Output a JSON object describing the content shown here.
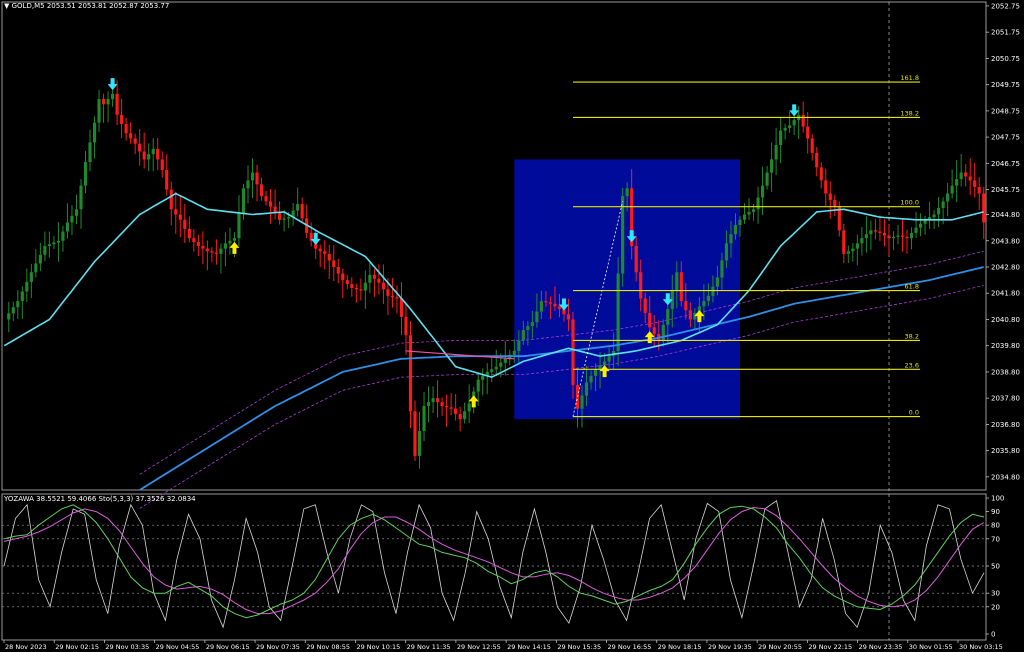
{
  "symbol_header": {
    "arrow": "▼",
    "symbol": "GOLD,M5",
    "ohlc": "2053.51 2053.81 2052.87 2053.77"
  },
  "indicator_header": {
    "name": "YOZAWA",
    "values": "38.5521 59.4066",
    "sto": "Sto(5,3,3)",
    "sto_values": "37.3526 32.0834"
  },
  "colors": {
    "background": "#000000",
    "bull_candle": "#1f8a2a",
    "bear_candle": "#ff1a1a",
    "ma_fast": "#5fe0f0",
    "ma_slow": "#2f8fe8",
    "envelope": "#a63bd6",
    "fib_line": "#e6e600",
    "fib_box": "#000c99",
    "arrow_up": "#ffee00",
    "arrow_down": "#33e6ff",
    "stoch_fast": "#d9d9d9",
    "stoch_main": "#5fd05f",
    "stoch_signal": "#d95fd9",
    "grid": "#c0c0c0"
  },
  "chart_data": [
    {
      "type": "candlestick",
      "ylim": [
        2034.3,
        2052.9
      ],
      "y_ticks": [
        "2052.75",
        "2051.75",
        "2050.75",
        "2049.75",
        "2048.75",
        "2047.75",
        "2046.75",
        "2045.75",
        "2044.80",
        "2043.80",
        "2042.80",
        "2041.80",
        "2040.80",
        "2039.80",
        "2038.80",
        "2037.80",
        "2036.80",
        "2035.80",
        "2034.80"
      ],
      "x_ticks": [
        "28 Nov 2023",
        "29 Nov 02:15",
        "29 Nov 03:35",
        "29 Nov 04:55",
        "29 Nov 06:15",
        "29 Nov 07:35",
        "29 Nov 08:55",
        "29 Nov 10:15",
        "29 Nov 11:35",
        "29 Nov 12:55",
        "29 Nov 14:15",
        "29 Nov 15:35",
        "29 Nov 16:55",
        "29 Nov 18:15",
        "29 Nov 19:35",
        "29 Nov 20:55",
        "29 Nov 22:15",
        "29 Nov 23:35",
        "30 Nov 01:55",
        "30 Nov 03:15"
      ],
      "close_path": [
        [
          0,
          2040.8
        ],
        [
          3,
          2041.5
        ],
        [
          6,
          2042.6
        ],
        [
          9,
          2043.6
        ],
        [
          12,
          2043.8
        ],
        [
          14,
          2044.5
        ],
        [
          16,
          2045.0
        ],
        [
          18,
          2046.8
        ],
        [
          20,
          2048.3
        ],
        [
          21,
          2049.2
        ],
        [
          22,
          2049.0
        ],
        [
          24,
          2049.4
        ],
        [
          25,
          2048.6
        ],
        [
          27,
          2047.9
        ],
        [
          29,
          2047.5
        ],
        [
          31,
          2046.9
        ],
        [
          33,
          2047.3
        ],
        [
          35,
          2046.5
        ],
        [
          37,
          2045.0
        ],
        [
          39,
          2044.6
        ],
        [
          41,
          2043.9
        ],
        [
          43,
          2043.6
        ],
        [
          45,
          2043.4
        ],
        [
          47,
          2043.3
        ],
        [
          49,
          2043.7
        ],
        [
          51,
          2043.9
        ],
        [
          53,
          2045.8
        ],
        [
          55,
          2046.4
        ],
        [
          57,
          2045.5
        ],
        [
          59,
          2045.1
        ],
        [
          61,
          2044.6
        ],
        [
          63,
          2044.7
        ],
        [
          65,
          2045.2
        ],
        [
          67,
          2044.1
        ],
        [
          69,
          2043.5
        ],
        [
          71,
          2043.3
        ],
        [
          73,
          2042.8
        ],
        [
          75,
          2042.3
        ],
        [
          77,
          2042.0
        ],
        [
          79,
          2041.9
        ],
        [
          81,
          2042.5
        ],
        [
          83,
          2042.2
        ],
        [
          85,
          2041.7
        ],
        [
          87,
          2041.6
        ],
        [
          89,
          2040.2
        ],
        [
          90,
          2037.3
        ],
        [
          91,
          2035.6
        ],
        [
          93,
          2037.5
        ],
        [
          95,
          2037.8
        ],
        [
          97,
          2037.5
        ],
        [
          99,
          2037.4
        ],
        [
          101,
          2037.0
        ],
        [
          103,
          2037.6
        ],
        [
          105,
          2038.5
        ],
        [
          107,
          2038.8
        ],
        [
          109,
          2039.0
        ],
        [
          111,
          2039.3
        ],
        [
          113,
          2039.6
        ],
        [
          115,
          2040.4
        ],
        [
          117,
          2040.7
        ],
        [
          119,
          2041.5
        ],
        [
          121,
          2041.4
        ],
        [
          123,
          2041.2
        ],
        [
          125,
          2040.8
        ],
        [
          126,
          2038.3
        ],
        [
          127,
          2037.4
        ],
        [
          129,
          2038.4
        ],
        [
          131,
          2038.9
        ],
        [
          133,
          2039.2
        ],
        [
          135,
          2039.6
        ],
        [
          137,
          2045.5
        ],
        [
          138,
          2045.8
        ],
        [
          139,
          2043.6
        ],
        [
          141,
          2041.6
        ],
        [
          143,
          2040.5
        ],
        [
          145,
          2040.0
        ],
        [
          147,
          2041.2
        ],
        [
          149,
          2042.6
        ],
        [
          150,
          2041.5
        ],
        [
          152,
          2040.8
        ],
        [
          154,
          2041.3
        ],
        [
          156,
          2041.7
        ],
        [
          158,
          2042.4
        ],
        [
          160,
          2043.7
        ],
        [
          162,
          2044.4
        ],
        [
          164,
          2044.8
        ],
        [
          166,
          2045.0
        ],
        [
          168,
          2045.9
        ],
        [
          170,
          2046.9
        ],
        [
          172,
          2048.0
        ],
        [
          174,
          2048.2
        ],
        [
          176,
          2048.6
        ],
        [
          178,
          2047.7
        ],
        [
          180,
          2046.6
        ],
        [
          182,
          2045.6
        ],
        [
          184,
          2045.1
        ],
        [
          186,
          2043.3
        ],
        [
          188,
          2043.5
        ],
        [
          190,
          2043.9
        ],
        [
          192,
          2044.2
        ],
        [
          194,
          2044.1
        ],
        [
          196,
          2043.9
        ],
        [
          198,
          2044.0
        ],
        [
          200,
          2043.9
        ],
        [
          202,
          2044.3
        ],
        [
          204,
          2044.6
        ],
        [
          206,
          2044.8
        ],
        [
          208,
          2045.3
        ],
        [
          210,
          2045.9
        ],
        [
          212,
          2046.4
        ],
        [
          214,
          2046.1
        ],
        [
          216,
          2045.6
        ],
        [
          217,
          2044.5
        ]
      ],
      "ma_fast": [
        [
          0,
          2039.8
        ],
        [
          10,
          2040.8
        ],
        [
          20,
          2043.0
        ],
        [
          30,
          2044.8
        ],
        [
          38,
          2045.6
        ],
        [
          45,
          2045.0
        ],
        [
          55,
          2044.8
        ],
        [
          62,
          2044.9
        ],
        [
          70,
          2044.1
        ],
        [
          80,
          2043.2
        ],
        [
          90,
          2041.2
        ],
        [
          100,
          2039.0
        ],
        [
          108,
          2038.6
        ],
        [
          115,
          2039.2
        ],
        [
          125,
          2039.7
        ],
        [
          132,
          2039.4
        ],
        [
          140,
          2039.6
        ],
        [
          150,
          2040.0
        ],
        [
          158,
          2040.6
        ],
        [
          165,
          2041.9
        ],
        [
          172,
          2043.6
        ],
        [
          180,
          2044.9
        ],
        [
          186,
          2045.0
        ],
        [
          194,
          2044.7
        ],
        [
          202,
          2044.6
        ],
        [
          210,
          2044.6
        ],
        [
          217,
          2044.9
        ]
      ],
      "ma_slow": [
        [
          30,
          2034.3
        ],
        [
          45,
          2035.9
        ],
        [
          60,
          2037.5
        ],
        [
          75,
          2038.8
        ],
        [
          88,
          2039.3
        ],
        [
          100,
          2039.4
        ],
        [
          115,
          2039.4
        ],
        [
          125,
          2039.6
        ],
        [
          135,
          2039.8
        ],
        [
          145,
          2040.1
        ],
        [
          155,
          2040.5
        ],
        [
          165,
          2040.9
        ],
        [
          175,
          2041.4
        ],
        [
          185,
          2041.7
        ],
        [
          195,
          2042.0
        ],
        [
          205,
          2042.3
        ],
        [
          217,
          2042.8
        ]
      ],
      "fibonacci": {
        "levels": [
          "161.8",
          "138.2",
          "100.0",
          "61.8",
          "38.2",
          "23.6",
          "0.0"
        ],
        "prices": [
          2049.85,
          2048.5,
          2045.1,
          2041.9,
          2040.0,
          2038.9,
          2037.1
        ],
        "box_price_range": [
          2037.0,
          2046.9
        ],
        "box_bar_range": [
          113,
          163
        ],
        "line_bar_start": 126
      },
      "signals": [
        {
          "bar": 24,
          "dir": "down"
        },
        {
          "bar": 51,
          "dir": "up"
        },
        {
          "bar": 69,
          "dir": "down"
        },
        {
          "bar": 104,
          "dir": "up"
        },
        {
          "bar": 124,
          "dir": "down"
        },
        {
          "bar": 133,
          "dir": "up"
        },
        {
          "bar": 139,
          "dir": "down"
        },
        {
          "bar": 143,
          "dir": "up"
        },
        {
          "bar": 147,
          "dir": "down"
        },
        {
          "bar": 154,
          "dir": "up"
        },
        {
          "bar": 175,
          "dir": "down"
        }
      ]
    },
    {
      "type": "line",
      "ylim": [
        0,
        100
      ],
      "y_ticks": [
        "100",
        "90",
        "80",
        "70",
        "50",
        "30",
        "20",
        "0"
      ],
      "levels": [
        80,
        70,
        50,
        30,
        20
      ],
      "main": [
        70,
        72,
        73,
        80,
        86,
        92,
        95,
        90,
        82,
        70,
        56,
        42,
        34,
        30,
        30,
        35,
        38,
        33,
        28,
        20,
        15,
        12,
        14,
        18,
        22,
        25,
        30,
        40,
        55,
        70,
        80,
        85,
        88,
        84,
        78,
        72,
        66,
        64,
        60,
        58,
        56,
        52,
        46,
        42,
        37,
        40,
        45,
        47,
        42,
        35,
        30,
        28,
        25,
        22,
        24,
        28,
        32,
        35,
        40,
        52,
        66,
        78,
        88,
        93,
        94,
        92,
        86,
        78,
        66,
        56,
        44,
        34,
        28,
        24,
        20,
        19,
        18,
        22,
        28,
        36,
        48,
        60,
        72,
        82,
        88,
        86
      ],
      "signal": [
        68,
        70,
        72,
        75,
        79,
        84,
        89,
        92,
        90,
        85,
        76,
        64,
        52,
        42,
        36,
        33,
        34,
        35,
        33,
        29,
        23,
        18,
        15,
        15,
        17,
        21,
        25,
        30,
        38,
        48,
        62,
        74,
        82,
        86,
        86,
        82,
        77,
        71,
        66,
        62,
        59,
        56,
        53,
        49,
        45,
        42,
        42,
        44,
        45,
        43,
        39,
        34,
        30,
        27,
        25,
        25,
        27,
        30,
        34,
        41,
        50,
        62,
        74,
        84,
        90,
        93,
        92,
        87,
        79,
        70,
        60,
        50,
        41,
        34,
        28,
        24,
        21,
        20,
        21,
        25,
        32,
        42,
        54,
        66,
        77,
        82
      ],
      "fast": [
        50,
        85,
        95,
        40,
        20,
        60,
        92,
        88,
        40,
        15,
        65,
        95,
        80,
        30,
        10,
        55,
        88,
        70,
        25,
        5,
        40,
        85,
        60,
        20,
        10,
        50,
        92,
        95,
        60,
        30,
        70,
        95,
        90,
        45,
        15,
        60,
        95,
        78,
        30,
        10,
        45,
        90,
        70,
        35,
        12,
        60,
        92,
        60,
        20,
        8,
        35,
        80,
        55,
        25,
        10,
        45,
        85,
        95,
        60,
        25,
        70,
        96,
        90,
        40,
        12,
        50,
        92,
        98,
        60,
        20,
        40,
        85,
        55,
        15,
        5,
        30,
        80,
        60,
        25,
        10,
        65,
        95,
        92,
        55,
        30,
        45
      ]
    }
  ]
}
